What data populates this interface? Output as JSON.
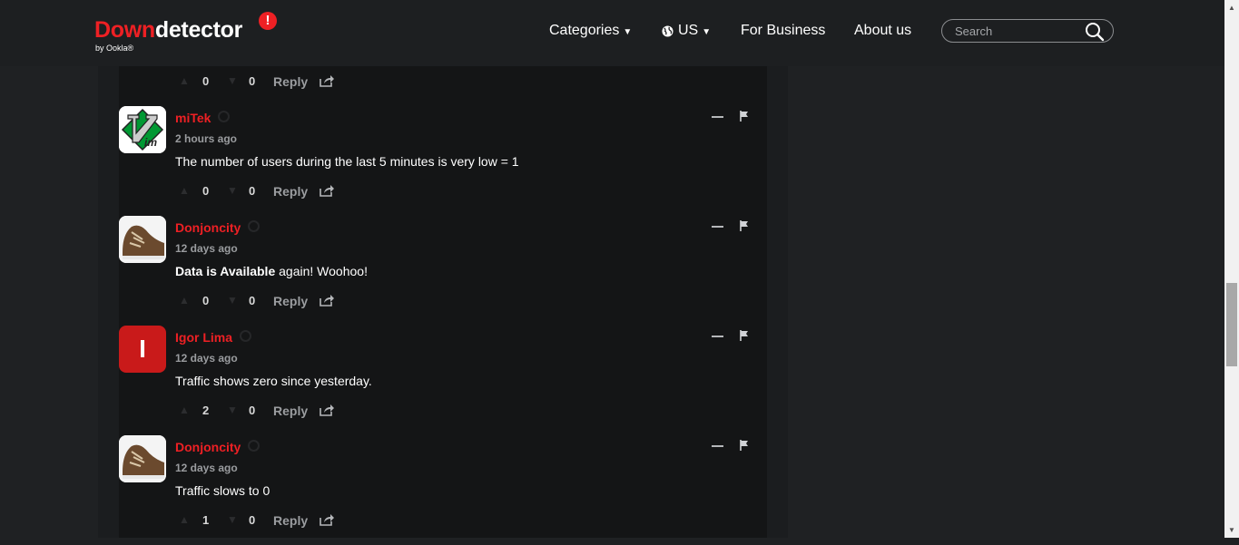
{
  "header": {
    "logo_down": "Down",
    "logo_rest": "detector",
    "logo_bang": "!",
    "logo_sub": "by Ookla®",
    "nav": {
      "categories": "Categories",
      "region": "US",
      "business": "For Business",
      "about": "About us"
    },
    "search_placeholder": "Search"
  },
  "colors": {
    "accent": "#ee2024",
    "background": "#1f2123",
    "panel": "#141516"
  },
  "top_actions": {
    "likes": "0",
    "dislikes": "0",
    "reply": "Reply"
  },
  "comments": [
    {
      "author": "miTek",
      "time": "2 hours ago",
      "text_plain": "The number of users during the last 5 minutes is very low = 1",
      "likes": "0",
      "dislikes": "0",
      "reply": "Reply",
      "avatar": "vim-logo"
    },
    {
      "author": "Donjoncity",
      "time": "12 days ago",
      "text_bold": "Data is Available",
      "text_plain": " again! Woohoo!",
      "likes": "0",
      "dislikes": "0",
      "reply": "Reply",
      "avatar": "sneaker-photo"
    },
    {
      "author": "Igor Lima",
      "time": "12 days ago",
      "text_plain": "Traffic shows zero since yesterday.",
      "likes": "2",
      "dislikes": "0",
      "reply": "Reply",
      "avatar": "letter-I",
      "avatar_letter": "I"
    },
    {
      "author": "Donjoncity",
      "time": "12 days ago",
      "text_plain": "Traffic slows to 0",
      "likes": "1",
      "dislikes": "0",
      "reply": "Reply",
      "avatar": "sneaker-photo"
    }
  ]
}
